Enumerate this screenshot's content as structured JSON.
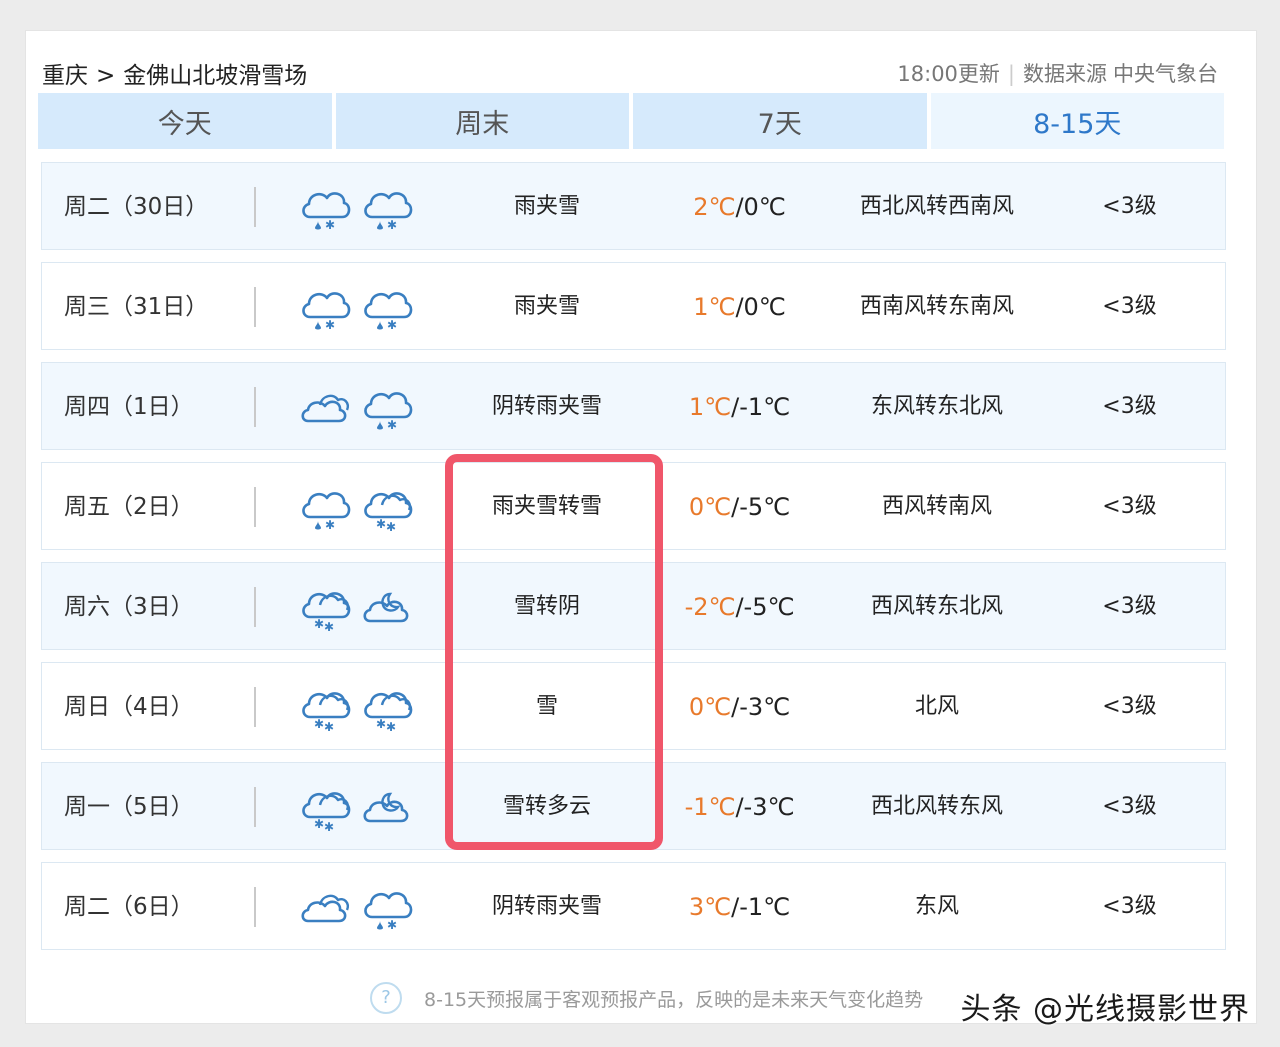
{
  "breadcrumb": {
    "city": "重庆",
    "separator": ">",
    "location": "金佛山北坡滑雪场"
  },
  "meta": {
    "update": "18:00更新",
    "source_label": "数据来源",
    "source": "中央气象台"
  },
  "tabs": [
    {
      "label": "今天"
    },
    {
      "label": "周末"
    },
    {
      "label": "7天"
    },
    {
      "label": "8-15天",
      "active": true
    }
  ],
  "forecast": [
    {
      "date": "周二（30日）",
      "icons": [
        "rain-snow-icon",
        "rain-snow-icon"
      ],
      "desc": "雨夹雪",
      "high": "2℃",
      "low": "/0℃",
      "wind": "西北风转西南风",
      "level": "<3级"
    },
    {
      "date": "周三（31日）",
      "icons": [
        "rain-snow-icon",
        "rain-snow-icon"
      ],
      "desc": "雨夹雪",
      "high": "1℃",
      "low": "/0℃",
      "wind": "西南风转东南风",
      "level": "<3级"
    },
    {
      "date": "周四（1日）",
      "icons": [
        "overcast-icon",
        "rain-snow-icon"
      ],
      "desc": "阴转雨夹雪",
      "high": "1℃",
      "low": "/-1℃",
      "wind": "东风转东北风",
      "level": "<3级"
    },
    {
      "date": "周五（2日）",
      "icons": [
        "rain-snow-icon",
        "snow-icon"
      ],
      "desc": "雨夹雪转雪",
      "high": "0℃",
      "low": "/-5℃",
      "wind": "西风转南风",
      "level": "<3级"
    },
    {
      "date": "周六（3日）",
      "icons": [
        "snow-icon",
        "cloudy-night-icon"
      ],
      "desc": "雪转阴",
      "high": "-2℃",
      "low": "/-5℃",
      "wind": "西风转东北风",
      "level": "<3级"
    },
    {
      "date": "周日（4日）",
      "icons": [
        "snow-icon",
        "snow-icon"
      ],
      "desc": "雪",
      "high": "0℃",
      "low": "/-3℃",
      "wind": "北风",
      "level": "<3级"
    },
    {
      "date": "周一（5日）",
      "icons": [
        "snow-icon",
        "cloudy-night-icon"
      ],
      "desc": "雪转多云",
      "high": "-1℃",
      "low": "/-3℃",
      "wind": "西北风转东风",
      "level": "<3级"
    },
    {
      "date": "周二（6日）",
      "icons": [
        "overcast-icon",
        "rain-snow-icon"
      ],
      "desc": "阴转雨夹雪",
      "high": "3℃",
      "low": "/-1℃",
      "wind": "东风",
      "level": "<3级"
    }
  ],
  "footer": {
    "note": "8-15天预报属于客观预报产品，反映的是未来天气变化趋势"
  },
  "watermark": "头条 @光线摄影世界",
  "colors": {
    "tab_bg": "#d6eafc",
    "tab_active_text": "#2e78c9",
    "temp_high": "#e87a2c",
    "highlight": "#f0566a",
    "icon": "#3a7fc1"
  }
}
